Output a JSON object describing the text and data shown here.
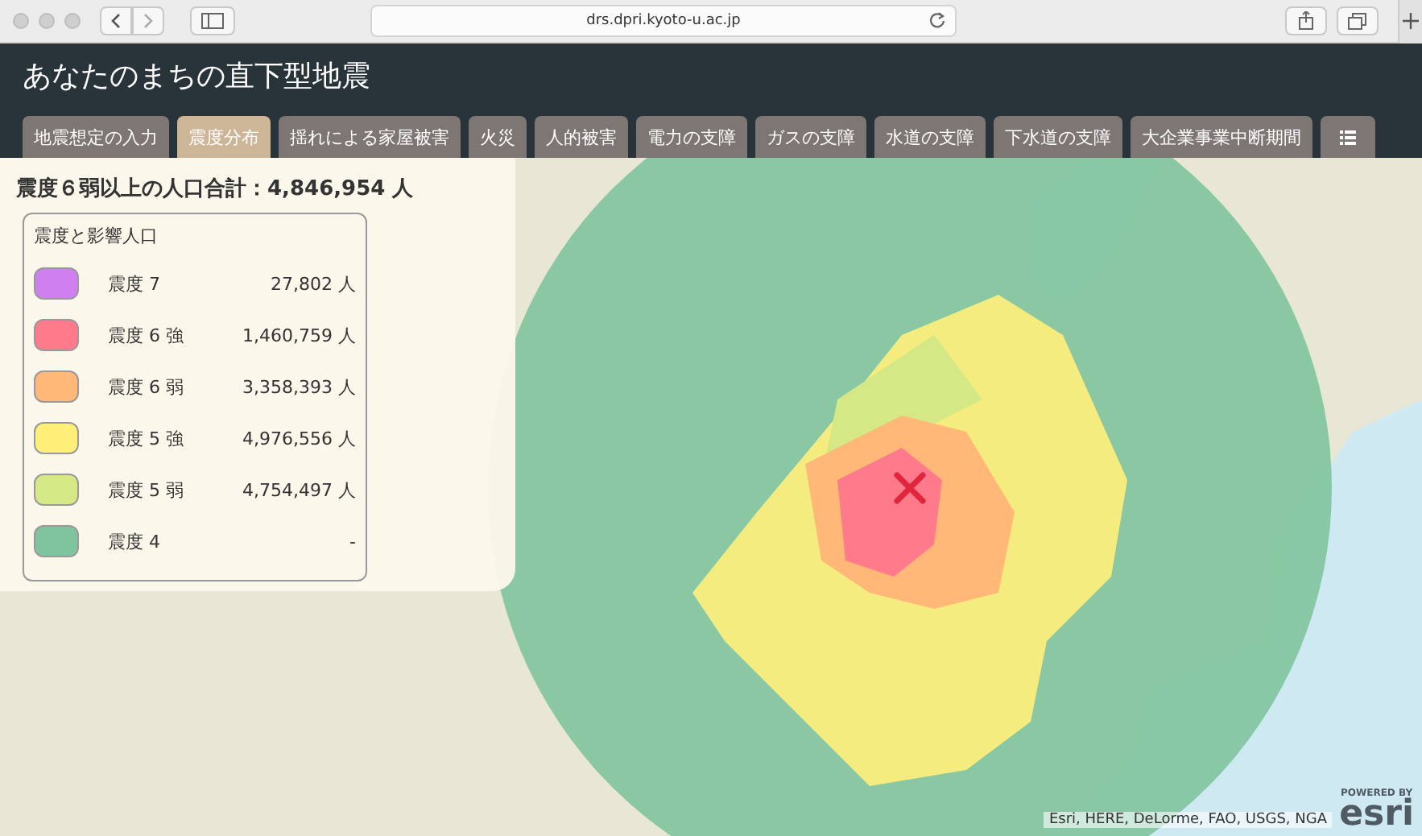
{
  "browser": {
    "url": "drs.dpri.kyoto-u.ac.jp"
  },
  "app": {
    "title": "あなたのまちの直下型地震"
  },
  "tabs": [
    {
      "kind": "text",
      "label": "地震想定の入力",
      "selected": false
    },
    {
      "kind": "text",
      "label": "震度分布",
      "selected": true
    },
    {
      "kind": "text",
      "label": "揺れによる家屋被害",
      "selected": false
    },
    {
      "kind": "text",
      "label": "火災",
      "selected": false
    },
    {
      "kind": "text",
      "label": "人的被害",
      "selected": false
    },
    {
      "kind": "text",
      "label": "電力の支障",
      "selected": false
    },
    {
      "kind": "text",
      "label": "ガスの支障",
      "selected": false
    },
    {
      "kind": "text",
      "label": "水道の支障",
      "selected": false
    },
    {
      "kind": "text",
      "label": "下水道の支障",
      "selected": false
    },
    {
      "kind": "text",
      "label": "大企業事業中断期間",
      "selected": false
    },
    {
      "kind": "icon",
      "selected": false
    }
  ],
  "summary": {
    "label": "震度６弱以上の人口合計：4,846,954 人"
  },
  "legend": {
    "title": "震度と影響人口",
    "items": [
      {
        "label": "震度 7",
        "value": "27,802 人",
        "color": "#d07ff0"
      },
      {
        "label": "震度 6 強",
        "value": "1,460,759 人",
        "color": "#ff7a8a"
      },
      {
        "label": "震度 6 弱",
        "value": "3,358,393 人",
        "color": "#ffb878"
      },
      {
        "label": "震度 5 強",
        "value": "4,976,556 人",
        "color": "#fff07a"
      },
      {
        "label": "震度 5 弱",
        "value": "4,754,497 人",
        "color": "#d4e886"
      },
      {
        "label": "震度 4",
        "value": "-",
        "color": "#7fc49f"
      }
    ]
  },
  "map": {
    "attribution": "Esri, HERE, DeLorme, FAO, USGS, NGA",
    "logo_caption": "POWERED BY",
    "logo": "esri"
  }
}
